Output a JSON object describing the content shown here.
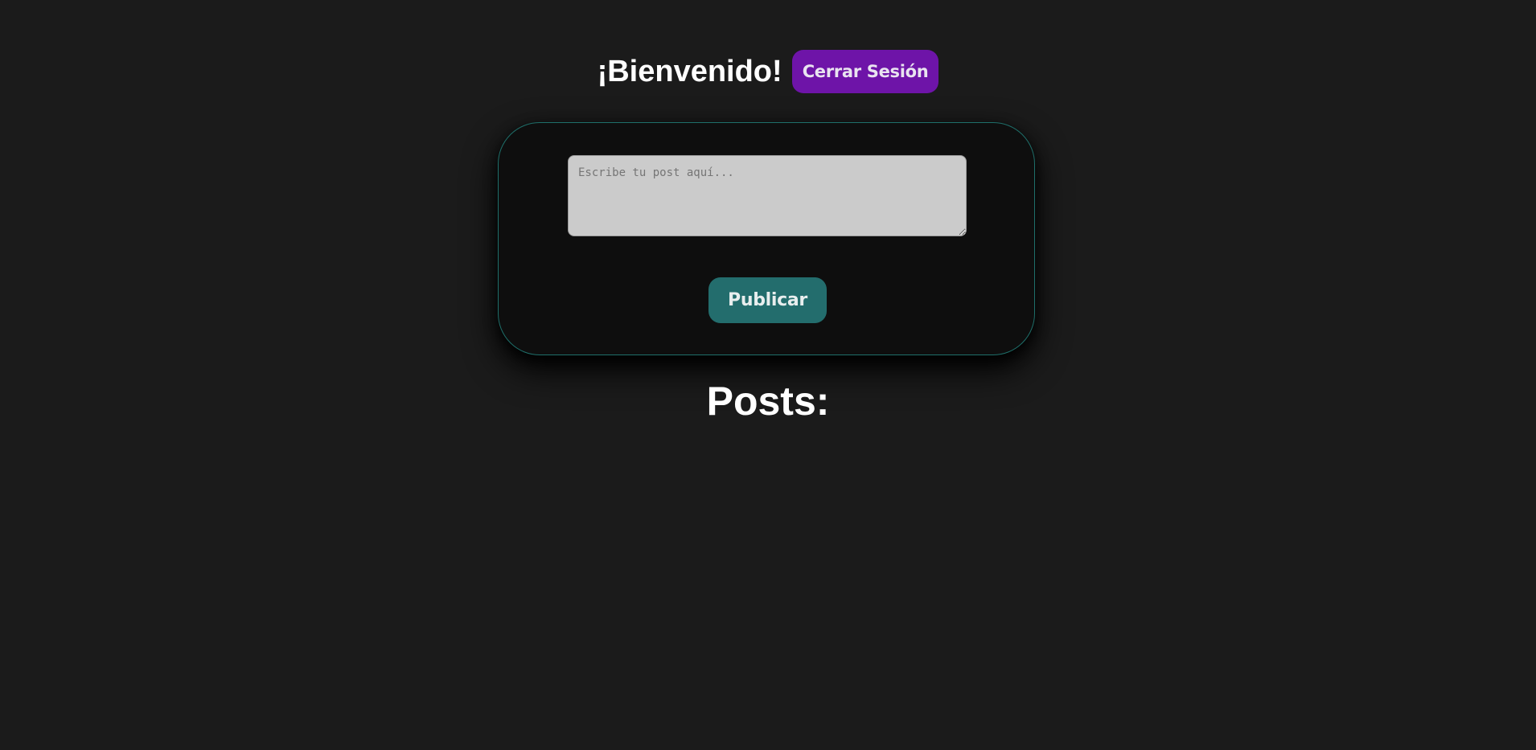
{
  "header": {
    "welcome_text": "¡Bienvenido!",
    "logout_label": "Cerrar Sesión"
  },
  "composer": {
    "placeholder": "Escribe tu post aquí...",
    "value": "",
    "publish_label": "Publicar"
  },
  "posts": {
    "title": "Posts:",
    "items": []
  },
  "colors": {
    "background": "#1b1b1b",
    "logout_button": "#6e14a8",
    "publish_button": "#236d6d",
    "card_border": "#1f6f6a"
  }
}
